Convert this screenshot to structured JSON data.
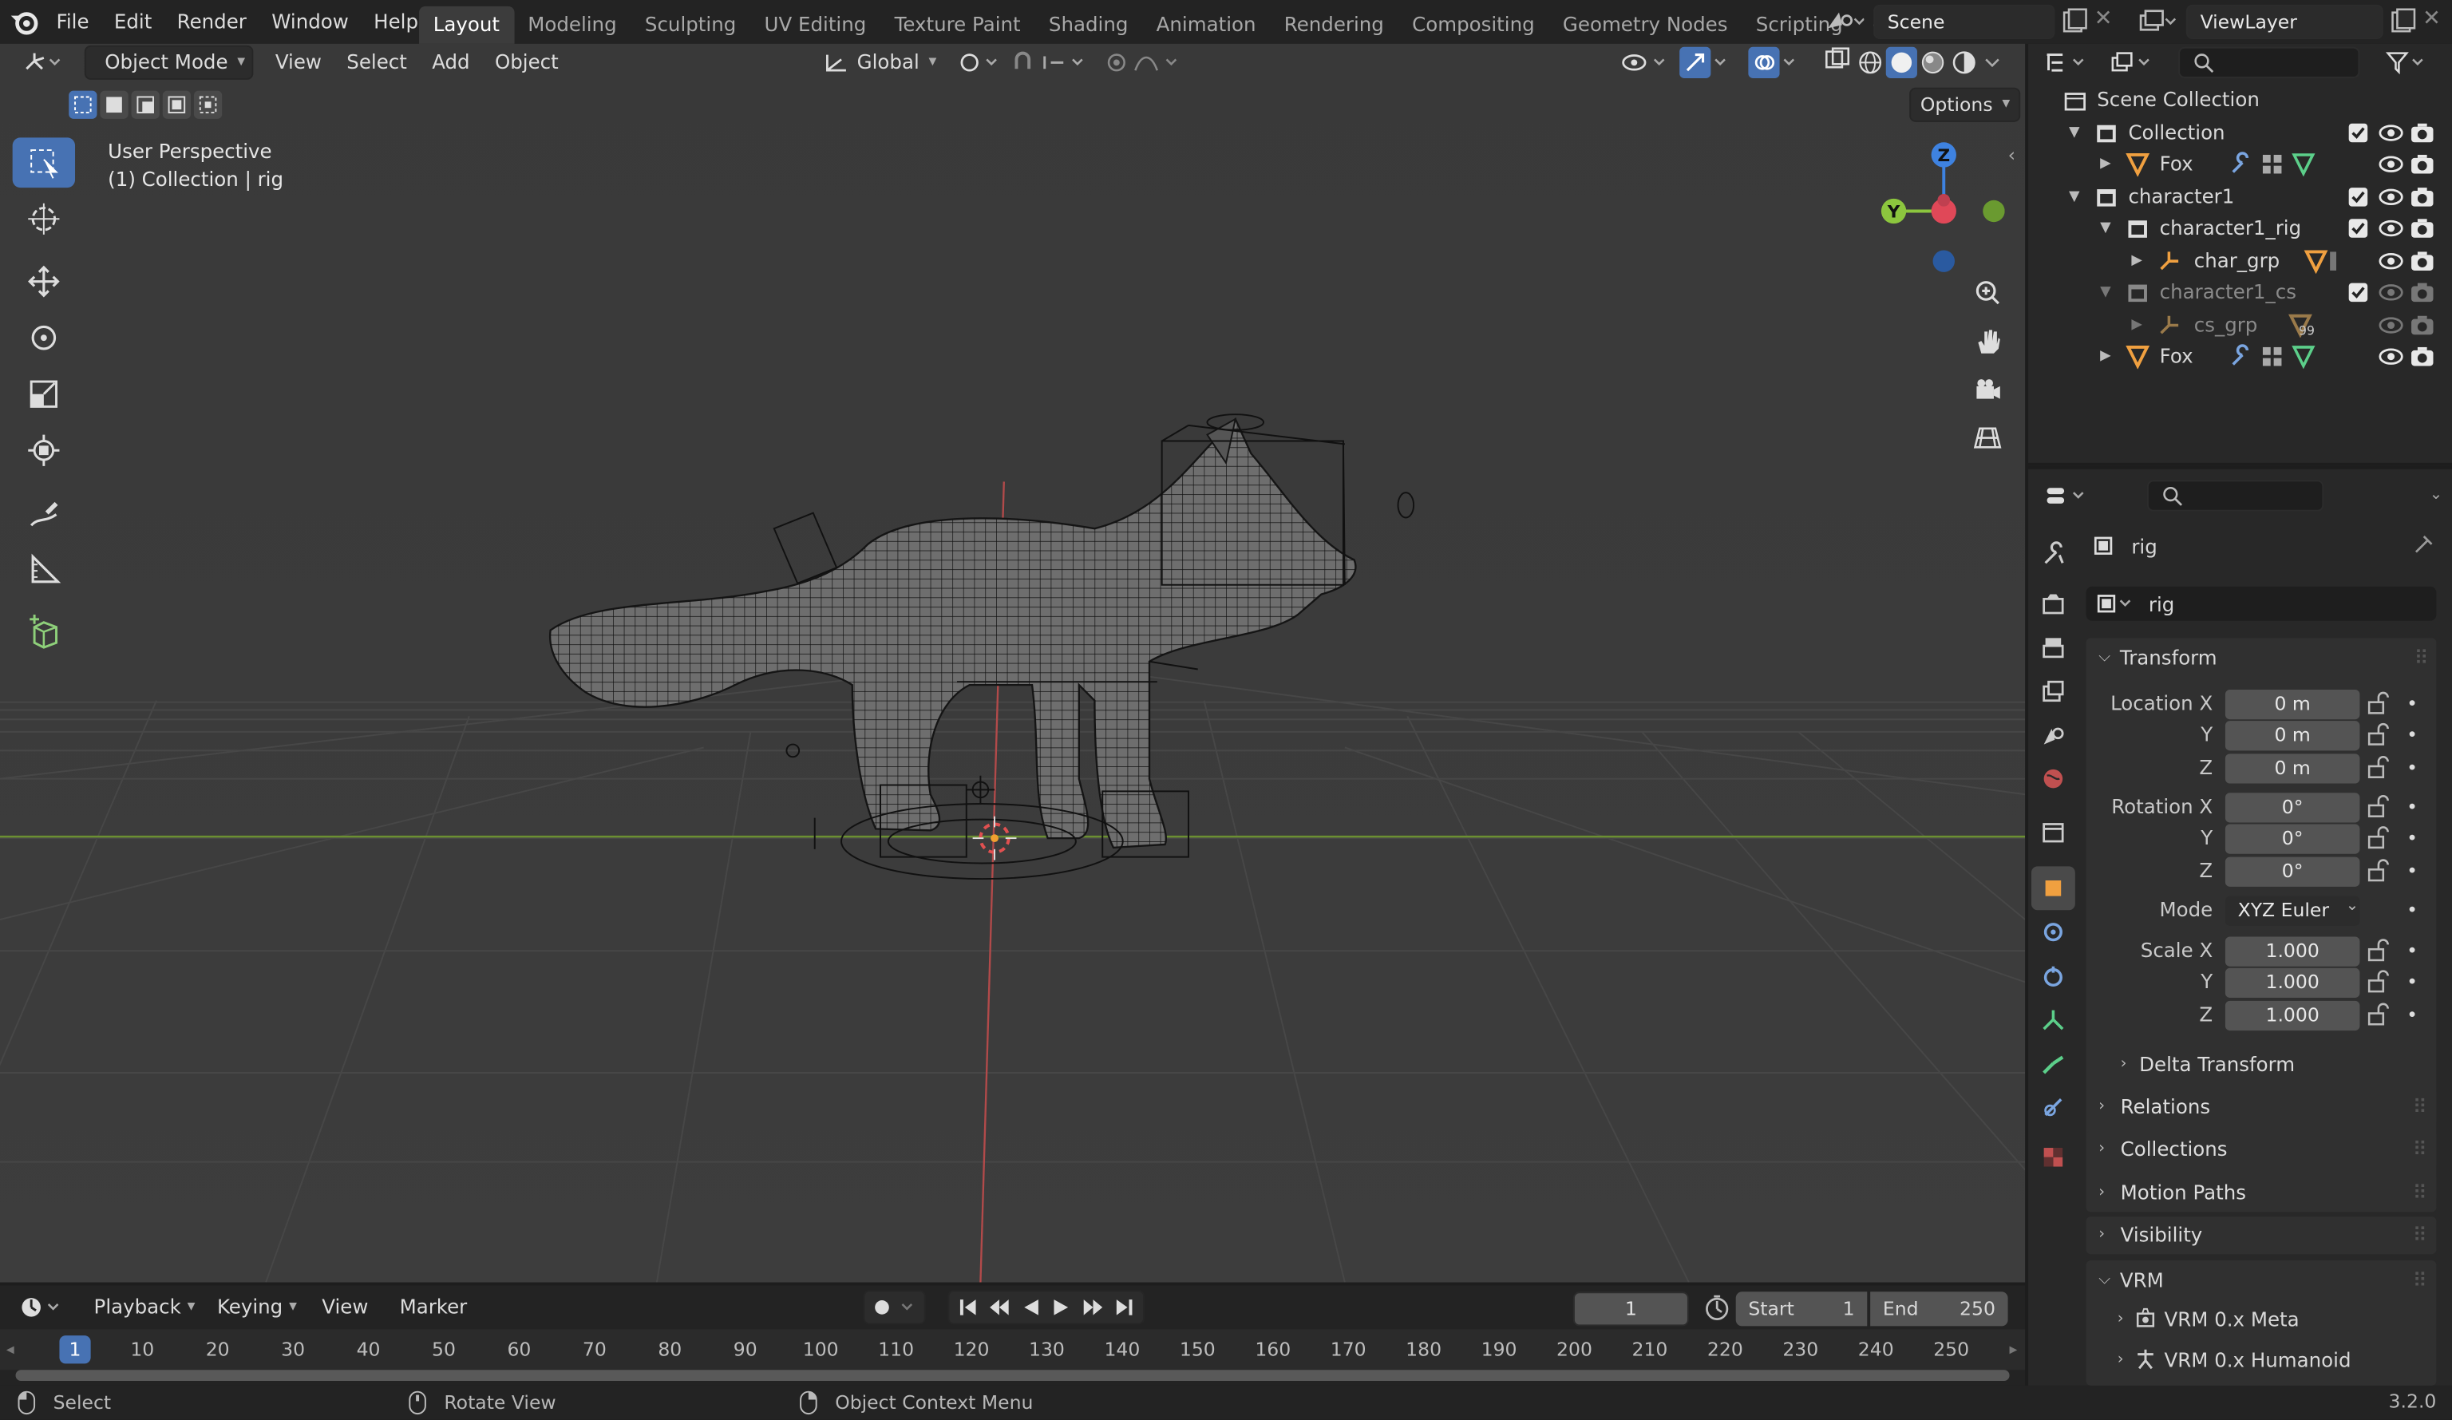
{
  "app": {
    "version": "3.2.0"
  },
  "topbar": {
    "menus": [
      "File",
      "Edit",
      "Render",
      "Window",
      "Help"
    ],
    "workspaces": [
      "Layout",
      "Modeling",
      "Sculpting",
      "UV Editing",
      "Texture Paint",
      "Shading",
      "Animation",
      "Rendering",
      "Compositing",
      "Geometry Nodes",
      "Scripting"
    ],
    "active_workspace": "Layout",
    "scene": "Scene",
    "view_layer": "ViewLayer"
  },
  "viewport": {
    "mode": "Object Mode",
    "menus": [
      "View",
      "Select",
      "Add",
      "Object"
    ],
    "orientation": "Global",
    "options_label": "Options",
    "perspective_label": "User Perspective",
    "collection_label": "(1) Collection | rig",
    "gizmo": {
      "z": "Z",
      "y": "Y"
    }
  },
  "outliner": {
    "root": "Scene Collection",
    "rows": [
      {
        "label": "Collection"
      },
      {
        "label": "Fox"
      },
      {
        "label": "character1"
      },
      {
        "label": "character1_rig"
      },
      {
        "label": "char_grp"
      },
      {
        "label": "character1_cs"
      },
      {
        "label": "cs_grp",
        "badge": "99"
      },
      {
        "label": "Fox"
      }
    ]
  },
  "properties": {
    "object_name": "rig",
    "data_name": "rig",
    "transform": {
      "title": "Transform",
      "location_label": "Location X",
      "location": [
        "0 m",
        "0 m",
        "0 m"
      ],
      "rotation_label": "Rotation X",
      "rotation": [
        "0°",
        "0°",
        "0°"
      ],
      "mode_label": "Mode",
      "mode": "XYZ Euler",
      "scale_label": "Scale X",
      "scale": [
        "1.000",
        "1.000",
        "1.000"
      ],
      "y": "Y",
      "z": "Z"
    },
    "panels": [
      "Delta Transform",
      "Relations",
      "Collections",
      "Motion Paths",
      "Visibility",
      "VRM"
    ],
    "vrm_children": [
      "VRM 0.x Meta",
      "VRM 0.x Humanoid"
    ]
  },
  "timeline": {
    "menus": [
      "Playback",
      "Keying",
      "View",
      "Marker"
    ],
    "current_frame": "1",
    "start_label": "Start",
    "start": "1",
    "end_label": "End",
    "end": "250",
    "ticks": [
      "1",
      "10",
      "20",
      "30",
      "40",
      "50",
      "60",
      "70",
      "80",
      "90",
      "100",
      "110",
      "120",
      "130",
      "140",
      "150",
      "160",
      "170",
      "180",
      "190",
      "200",
      "210",
      "220",
      "230",
      "240",
      "250"
    ]
  },
  "statusbar": {
    "items": [
      "Select",
      "Rotate View",
      "Object Context Menu"
    ]
  },
  "colors": {
    "accent": "#4772b3",
    "x_axis": "#e04858",
    "y_axis": "#8cc63e",
    "z_axis": "#3e82e0"
  }
}
